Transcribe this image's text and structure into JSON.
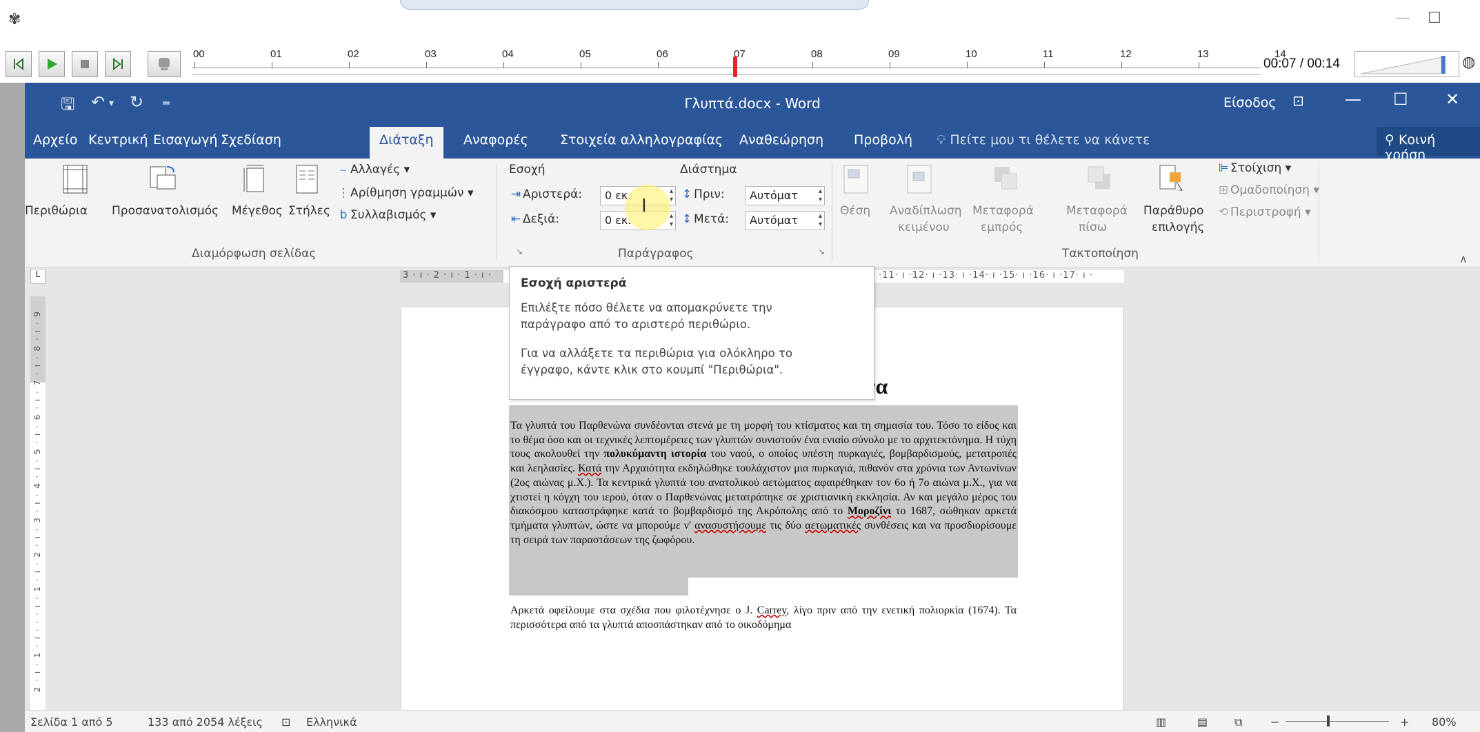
{
  "player": {
    "timeline_labels": [
      "00",
      "01",
      "02",
      "03",
      "04",
      "05",
      "06",
      "07",
      "08",
      "09",
      "10",
      "11",
      "12",
      "13",
      "14"
    ],
    "time_readout": "00:07 / 00:14",
    "progress": 0.5,
    "volume": 0.8,
    "buttons": [
      "rewind-start-icon",
      "play-icon",
      "stop-icon",
      "forward-end-icon",
      "record-icon"
    ]
  },
  "word": {
    "doc_title": "Γλυπτά.docx  -  Word",
    "sign_in": "Είσοδος",
    "tabs": [
      "Αρχείο",
      "Κεντρική",
      "Εισαγωγή",
      "Σχεδίαση",
      "Διάταξη",
      "Αναφορές",
      "Στοιχεία αλληλογραφίας",
      "Αναθεώρηση",
      "Προβολή"
    ],
    "active_tab": "Διάταξη",
    "tell_me": "Πείτε μου τι θέλετε να κάνετε",
    "share": "Κοινή χρήση",
    "ribbon": {
      "page_setup": {
        "title": "Διαμόρφωση σελίδας",
        "margins": "Περιθώρια",
        "orientation": "Προσανατολισμός",
        "size": "Μέγεθος",
        "columns": "Στήλες",
        "breaks": "Αλλαγές",
        "line_numbers": "Αρίθμηση γραμμών",
        "hyphenation": "Συλλαβισμός"
      },
      "paragraph": {
        "title": "Παράγραφος",
        "indent_header": "Εσοχή",
        "spacing_header": "Διάστημα",
        "left_label": "Αριστερά:",
        "left_value": "0 εκ.",
        "right_label": "Δεξιά:",
        "right_value": "0 εκ.",
        "before_label": "Πριν:",
        "before_value": "Αυτόματ",
        "after_label": "Μετά:",
        "after_value": "Αυτόματ"
      },
      "arrange": {
        "title": "Τακτοποίηση",
        "position": "Θέση",
        "wrap_1": "Αναδίπλωση",
        "wrap_2": "κειμένου",
        "forward_1": "Μεταφορά",
        "forward_2": "εμπρός",
        "backward_1": "Μεταφορά",
        "backward_2": "πίσω",
        "pane_1": "Παράθυρο",
        "pane_2": "επιλογής",
        "align": "Στοίχιση",
        "group": "Ομαδοποίηση",
        "rotate": "Περιστροφή"
      }
    },
    "ruler_top": "3 · ı · 2 · ı · 1 · ı ·",
    "ruler_top_right": "·11· ı ·12· ı ·13· ı ·14· ı ·15· ı ·16· ı ·17· ı ·",
    "ruler_left": "2 · ı · 1 · ı · · · ı · 1 · ı · 2 · ı · 3 · ı · 4 · ı · 5 · ı · 6 · ı · 7 · ı · 8 · ı · 9",
    "tooltip": {
      "title": "Εσοχή αριστερά",
      "line1": "Επιλέξτε πόσο θέλετε να απομακρύνετε την",
      "line2": "παράγραφο από το αριστερό περιθώριο.",
      "line3": "Για να αλλάξετε τα περιθώρια για ολόκληρο το",
      "line4": "έγγραφο, κάντε κλικ στο κουμπί \"Περιθώρια\"."
    },
    "document": {
      "heading": "Τα γλυπτά του Παρθενώνα",
      "p1_a": "Τα γλυπτά του Παρθενώνα συνδέονται στενά με τη μορφή του κτίσματος και τη σημασία του. Τόσο το είδος και το θέμα όσο και οι τεχνικές λεπτομέρειες των γλυπτών συνιστούν ένα ενιαίο σύνολο με το αρχιτεκτόνημα. Η τύχη τους ακολουθεί την ",
      "p1_bold": "πολυκύμαντη ιστορία",
      "p1_b": " του ναού, ο οποίος υπέστη πυρκαγιές, βομβαρδισμούς, μετατροπές και λεηλασίες. ",
      "p1_c1": "Κατά",
      "p1_c": " την Αρχαιότητα εκδηλώθηκε τουλάχιστον μια πυρκαγιά, πιθανόν στα χρόνια των Αντωνίνων (2ος αιώνας μ.Χ.). Τα κεντρικά γλυπτά του ανατολικού αετώματος αφαιρέθηκαν τον 6ο ή 7ο αιώνα μ.Χ., για να χτιστεί η κόγχη του ιερού, όταν ο Παρθενώνας μετατράπηκε σε χριστιανική εκκλησία. Αν και μεγάλο μέρος του διακόσμου καταστράφηκε κατά το βομβαρδισμό της Ακρόπολης από το ",
      "p1_bold2": "Μοροζίνι",
      "p1_d": " το 1687, σώθηκαν αρκετά τμήματα γλυπτών, ώστε να μπορούμε ν' ",
      "p1_e1": "ανασυστήσουμε",
      "p1_e": " τις δύο ",
      "p1_e2": "αετωματικές",
      "p1_f": " συνθέσεις και να προσδιορίσουμε τη σειρά των παραστάσεων της ζωφόρου.",
      "p2_a": "Αρκετά οφείλουμε στα σχέδια που φιλοτέχνησε ο J. ",
      "p2_name": "Carrey",
      "p2_b": ", λίγο πριν από την ενετική πολιορκία (1674). Τα περισσότερα από τα γλυπτά αποσπάστηκαν από το οικοδόμημα"
    },
    "status": {
      "page": "Σελίδα 1 από 5",
      "words": "133 από 2054 λέξεις",
      "language": "Ελληνικά",
      "zoom": "80%"
    }
  }
}
